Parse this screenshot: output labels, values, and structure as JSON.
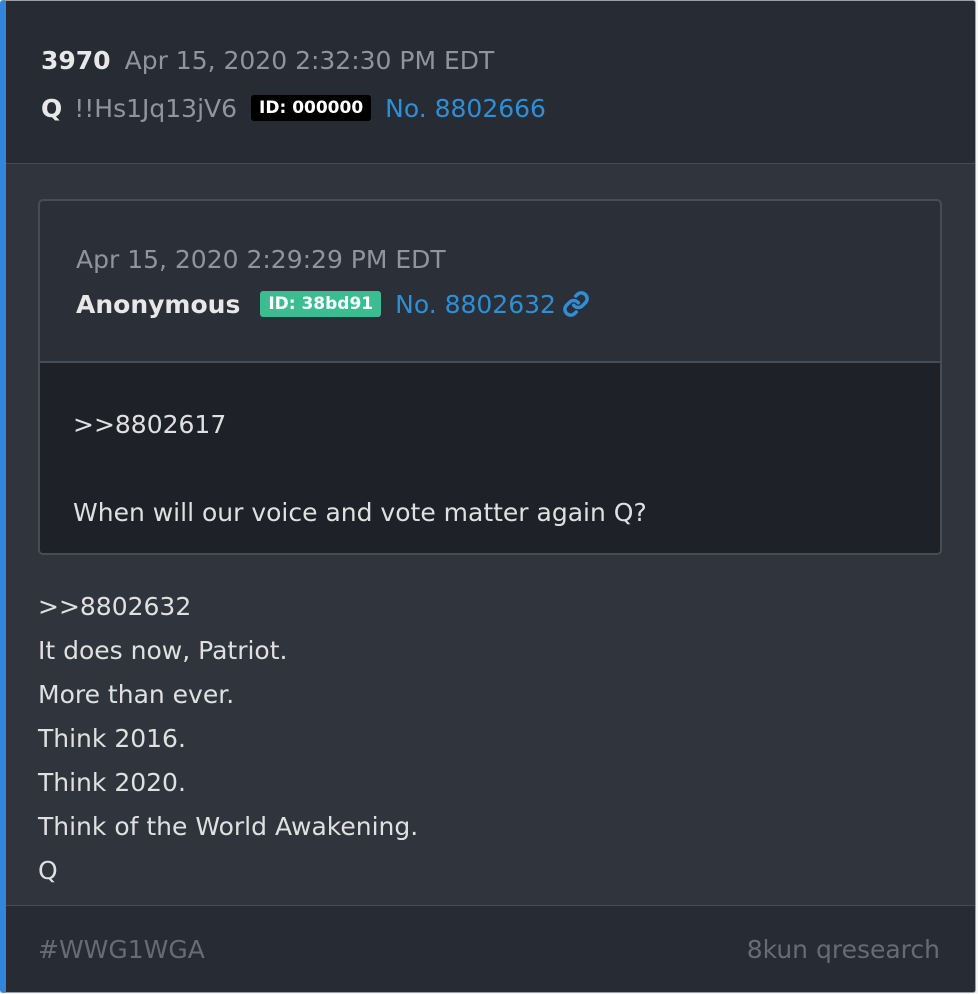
{
  "post": {
    "number": "3970",
    "timestamp": "Apr 15, 2020 2:32:30 PM EDT",
    "author": "Q",
    "tripcode": "!!Hs1Jq13jV6",
    "id_badge": "ID: 000000",
    "post_link": "No. 8802666"
  },
  "quoted": {
    "timestamp": "Apr 15, 2020 2:29:29 PM EDT",
    "author": "Anonymous",
    "id_badge": "ID: 38bd91",
    "post_link": "No. 8802632",
    "link_icon": "link-icon",
    "lines": [
      ">>8802617",
      "When will our voice and vote matter again Q?"
    ]
  },
  "body": {
    "lines": [
      ">>8802632",
      "It does now, Patriot.",
      "More than ever.",
      "Think 2016.",
      "Think 2020.",
      "Think of the World Awakening.",
      "Q"
    ]
  },
  "footer": {
    "hashtag": "#WWG1WGA",
    "source": "8kun qresearch"
  },
  "colors": {
    "accent_border": "#2e86de",
    "link": "#2e8fd6",
    "id_green": "#3bbd91"
  }
}
